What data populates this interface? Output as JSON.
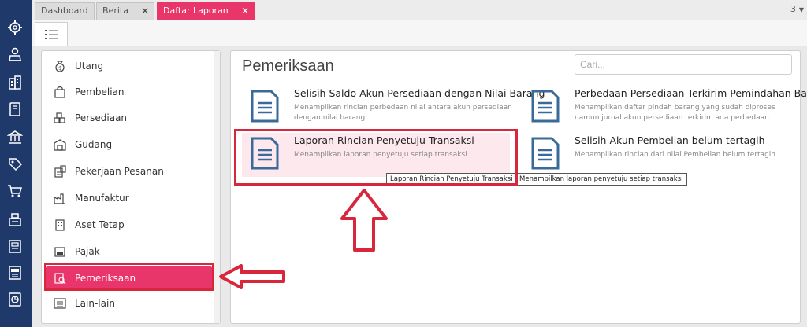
{
  "tabs": [
    {
      "label": "Dashboard",
      "closable": false,
      "active": false
    },
    {
      "label": "Berita",
      "closable": true,
      "active": false
    },
    {
      "label": "Daftar Laporan",
      "closable": true,
      "active": true
    }
  ],
  "tab_count": "3",
  "rail_icons": [
    "settings-icon",
    "user-tie-icon",
    "building-icon",
    "book-icon",
    "bank-icon",
    "tag-icon",
    "shopping-cart-icon",
    "cash-register-icon",
    "ledger-icon",
    "tax-icon",
    "report-chart-icon"
  ],
  "categories": [
    {
      "label": "Utang",
      "icon": "money-bag-icon"
    },
    {
      "label": "Pembelian",
      "icon": "shopping-bag-icon"
    },
    {
      "label": "Persediaan",
      "icon": "boxes-icon"
    },
    {
      "label": "Gudang",
      "icon": "warehouse-icon"
    },
    {
      "label": "Pekerjaan Pesanan",
      "icon": "job-order-icon"
    },
    {
      "label": "Manufaktur",
      "icon": "factory-icon"
    },
    {
      "label": "Aset Tetap",
      "icon": "fixed-asset-icon"
    },
    {
      "label": "Pajak",
      "icon": "tax-icon"
    },
    {
      "label": "Pemeriksaan",
      "icon": "audit-icon",
      "active": true
    },
    {
      "label": "Lain-lain",
      "icon": "list-icon"
    }
  ],
  "main": {
    "title": "Pemeriksaan",
    "search_placeholder": "Cari...",
    "reports": [
      {
        "title": "Selisih Saldo Akun Persediaan dengan Nilai Barang",
        "desc": "Menampilkan rincian perbedaan nilai antara akun persediaan dengan nilai barang"
      },
      {
        "title": "Perbedaan Persediaan Terkirim Pemindahan Barang",
        "desc": "Menampilkan daftar pindah barang yang sudah diproses namun jurnal akun persediaan terkirim ada perbedaan"
      },
      {
        "title": "Laporan Rincian Penyetuju Transaksi",
        "desc": "Menampilkan laporan penyetuju setiap transaksi"
      },
      {
        "title": "Selisih Akun Pembelian belum tertagih",
        "desc": "Menampilkan rincian dari nilai Pembelian belum tertagih"
      }
    ],
    "tooltip": "Laporan Rincian Penyetuju Transaksi - Menampilkan laporan penyetuju setiap transaksi"
  },
  "colors": {
    "accent": "#e8356a",
    "rail": "#1f3a6a",
    "annotation": "#d8263d",
    "doc_icon": "#3a6a9a"
  }
}
